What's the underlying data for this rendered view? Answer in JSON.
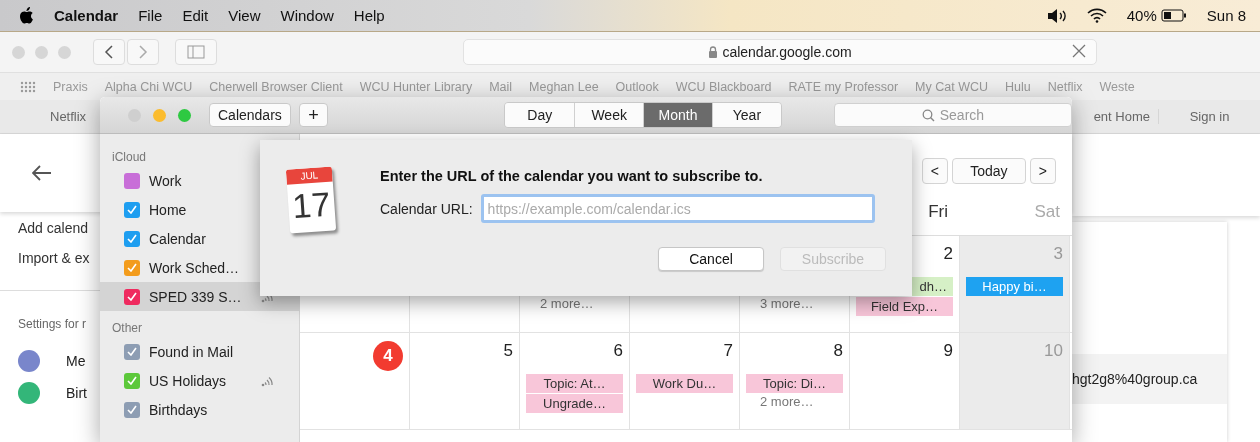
{
  "menu_bar": {
    "app": "Calendar",
    "menus": [
      "File",
      "Edit",
      "View",
      "Window",
      "Help"
    ],
    "battery": "40%",
    "clock": "Sun 8"
  },
  "browser": {
    "url": "calendar.google.com",
    "bookmarks": [
      "Praxis",
      "Alpha Chi WCU",
      "Cherwell Browser Client",
      "WCU Hunter Library",
      "Mail",
      "Meghan Lee",
      "Outlook",
      "WCU Blackboard",
      "RATE my Professor",
      "My Cat WCU",
      "Hulu",
      "Netflix",
      "Weste"
    ],
    "favorites_left": [
      "Netflix"
    ],
    "favorites_right": [
      "ent Home",
      "Sign in"
    ]
  },
  "page": {
    "add_calendar": "Add calend",
    "import_export": "Import & ex",
    "settings_for": "Settings for r",
    "my_calendars": [
      {
        "name": "Me",
        "color": "#7986cb"
      },
      {
        "name": "Birt",
        "color": "#33b679"
      }
    ],
    "calendar_id": "hgt2g8%40group.ca"
  },
  "calendar_app": {
    "calendars_button": "Calendars",
    "add_button": "+",
    "views": [
      {
        "label": "Day",
        "selected": false
      },
      {
        "label": "Week",
        "selected": false
      },
      {
        "label": "Month",
        "selected": true
      },
      {
        "label": "Year",
        "selected": false
      }
    ],
    "search": {
      "placeholder": "Search"
    },
    "sidebar": [
      {
        "title": "iCloud",
        "items": [
          {
            "name": "Work",
            "color": "#c86ed8",
            "checked": false,
            "selected": false
          },
          {
            "name": "Home",
            "color": "#1e9ef0",
            "checked": true,
            "selected": false
          },
          {
            "name": "Calendar",
            "color": "#1e9ef0",
            "checked": true,
            "selected": false
          },
          {
            "name": "Work Sched…",
            "color": "#f39c1c",
            "checked": true,
            "selected": false
          },
          {
            "name": "SPED 339 S…",
            "color": "#ef2a5f",
            "checked": true,
            "selected": true,
            "shared": true
          }
        ]
      },
      {
        "title": "Other",
        "items": [
          {
            "name": "Found in Mail",
            "color": "#8d9db3",
            "checked": true,
            "selected": false,
            "shared": false
          },
          {
            "name": "US Holidays",
            "color": "#5cc83a",
            "checked": true,
            "selected": false,
            "shared": true
          },
          {
            "name": "Birthdays",
            "color": "#8d9db3",
            "checked": true,
            "selected": false,
            "shared": false
          }
        ]
      }
    ],
    "nav": {
      "prev": "<",
      "today": "Today",
      "next": ">"
    },
    "weekdays": [
      "Fri",
      "Sat"
    ],
    "weeks": [
      {
        "days": [
          {
            "shaded": false
          },
          {
            "shaded": false
          },
          {
            "shaded": false,
            "more": "2 more…"
          },
          {
            "shaded": false
          },
          {
            "shaded": false,
            "more": "3 more…"
          },
          {
            "number": "2",
            "shaded": false,
            "today": false,
            "events": [
              {
                "text": "dh…",
                "color": "#d6f0c6"
              },
              {
                "text": "Field Exp…",
                "color": "#f8c6d9"
              }
            ]
          },
          {
            "number": "3",
            "shaded": true,
            "today": false,
            "events": [
              {
                "text": "Happy bi…",
                "color": "#1ea2f1"
              }
            ]
          }
        ]
      },
      {
        "days": [
          {
            "number": "4",
            "shaded": false,
            "today": true
          },
          {
            "number": "5",
            "shaded": false,
            "today": false
          },
          {
            "number": "6",
            "shaded": false,
            "today": false,
            "events": [
              {
                "text": "Topic: At…",
                "color": "#f8c6d9"
              },
              {
                "text": "Ungrade…",
                "color": "#f8c6d9"
              }
            ]
          },
          {
            "number": "7",
            "shaded": false,
            "today": false,
            "events": [
              {
                "text": "Work Du…",
                "color": "#f8c6d9"
              }
            ]
          },
          {
            "number": "8",
            "shaded": false,
            "today": false,
            "events": [
              {
                "text": "Topic: Di…",
                "color": "#f8c6d9"
              }
            ],
            "more": "2 more…"
          },
          {
            "number": "9",
            "shaded": false,
            "today": false
          },
          {
            "number": "10",
            "shaded": true,
            "today": false
          }
        ]
      }
    ],
    "dialog": {
      "icon_month": "JUL",
      "icon_day": "17",
      "message": "Enter the URL of the calendar you want to subscribe to.",
      "url_label": "Calendar URL:",
      "url_placeholder": "https://example.com/calendar.ics",
      "cancel": "Cancel",
      "subscribe": "Subscribe",
      "subscribe_disabled": true
    }
  }
}
